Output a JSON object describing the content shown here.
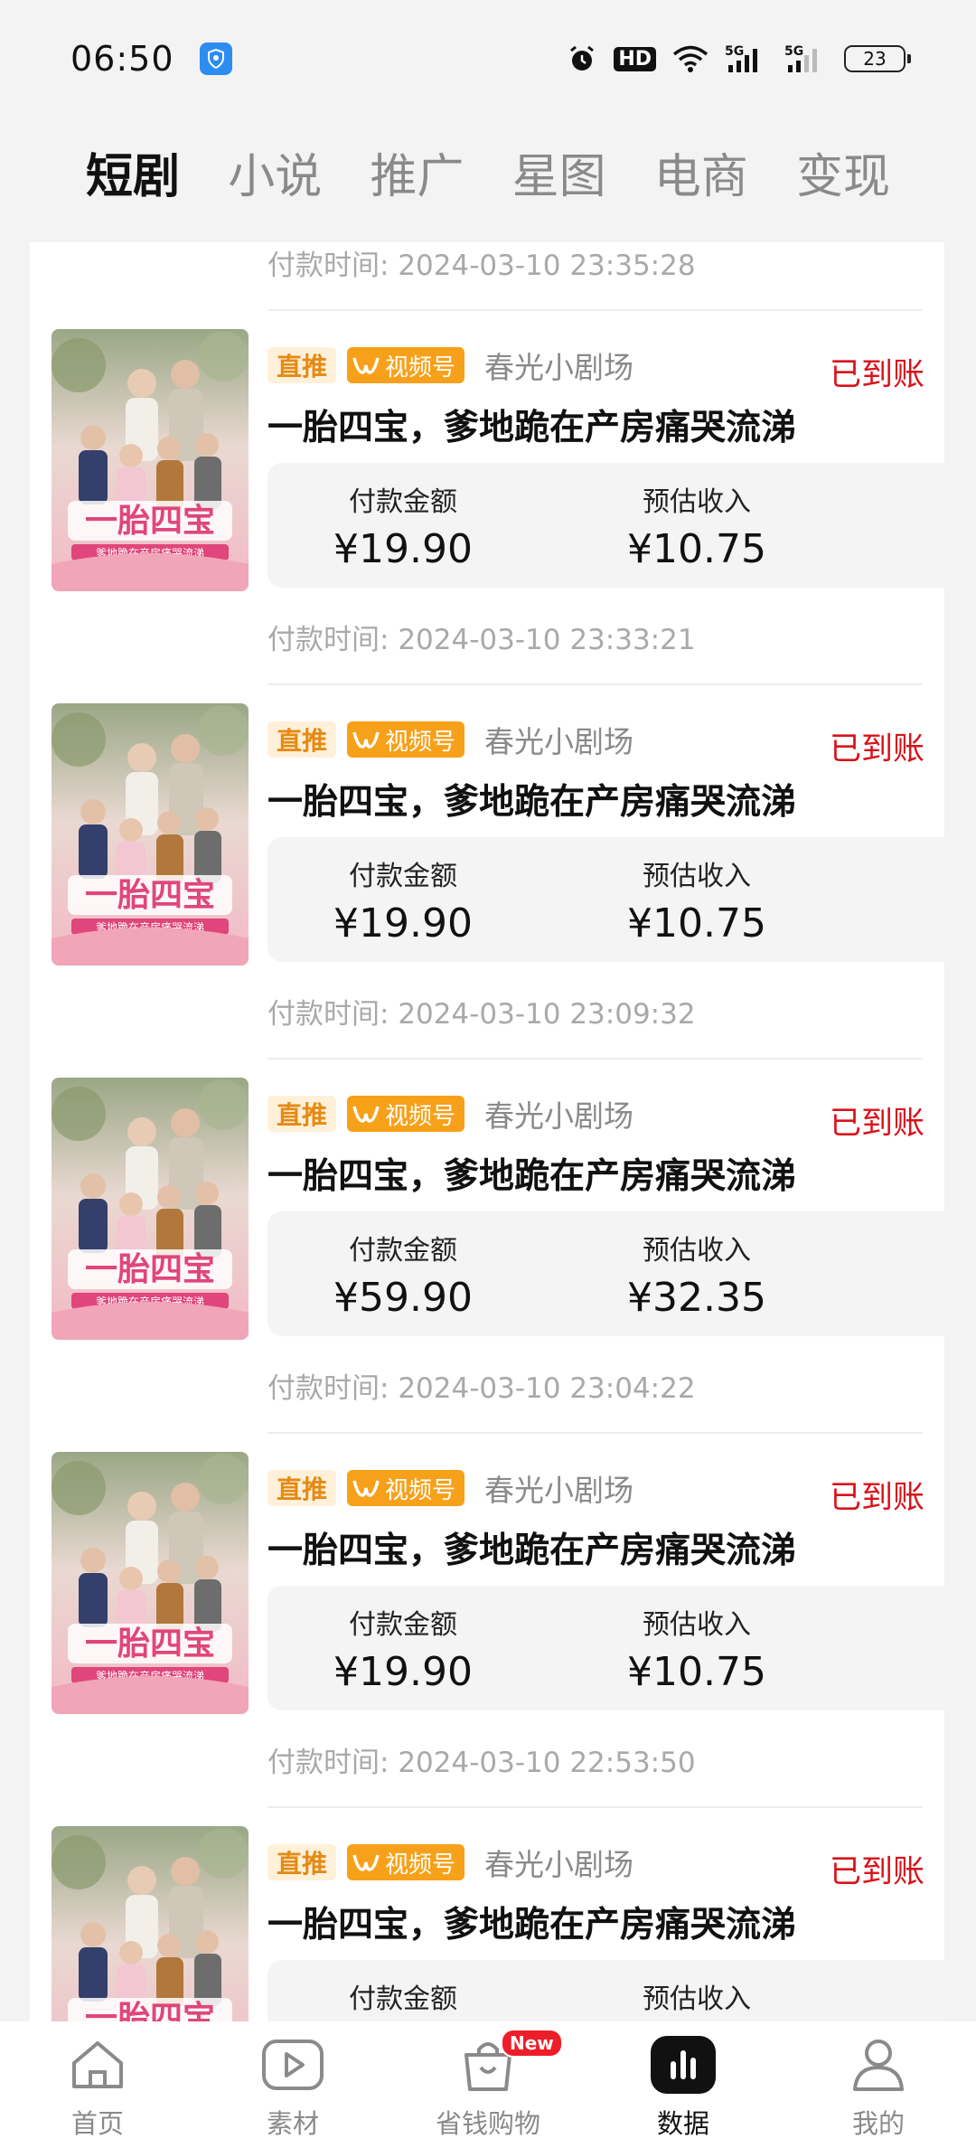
{
  "status_bar": {
    "time": "06:50",
    "hd_label": "HD",
    "signal1": "5G",
    "signal2": "5G",
    "battery": "23"
  },
  "tabs": [
    {
      "label": "短剧",
      "active": true
    },
    {
      "label": "小说",
      "active": false
    },
    {
      "label": "推广",
      "active": false
    },
    {
      "label": "星图",
      "active": false
    },
    {
      "label": "电商",
      "active": false
    },
    {
      "label": "变现",
      "active": false
    }
  ],
  "pay_time_label": "付款时间:",
  "orders_top_time": "2024-03-10 23:35:28",
  "orders": [
    {
      "tag_direct": "直推",
      "tag_channel": "视频号",
      "theater": "春光小剧场",
      "status": "已到账",
      "title": "一胎四宝，爹地跪在产房痛哭流涕",
      "pay_label": "付款金额",
      "pay_amount": "¥19.90",
      "income_label": "预估收入",
      "income_amount": "¥10.75",
      "pay_time": "2024-03-10 23:33:21"
    },
    {
      "tag_direct": "直推",
      "tag_channel": "视频号",
      "theater": "春光小剧场",
      "status": "已到账",
      "title": "一胎四宝，爹地跪在产房痛哭流涕",
      "pay_label": "付款金额",
      "pay_amount": "¥19.90",
      "income_label": "预估收入",
      "income_amount": "¥10.75",
      "pay_time": "2024-03-10 23:09:32"
    },
    {
      "tag_direct": "直推",
      "tag_channel": "视频号",
      "theater": "春光小剧场",
      "status": "已到账",
      "title": "一胎四宝，爹地跪在产房痛哭流涕",
      "pay_label": "付款金额",
      "pay_amount": "¥59.90",
      "income_label": "预估收入",
      "income_amount": "¥32.35",
      "pay_time": "2024-03-10 23:04:22"
    },
    {
      "tag_direct": "直推",
      "tag_channel": "视频号",
      "theater": "春光小剧场",
      "status": "已到账",
      "title": "一胎四宝，爹地跪在产房痛哭流涕",
      "pay_label": "付款金额",
      "pay_amount": "¥19.90",
      "income_label": "预估收入",
      "income_amount": "¥10.75",
      "pay_time": "2024-03-10 22:53:50"
    },
    {
      "tag_direct": "直推",
      "tag_channel": "视频号",
      "theater": "春光小剧场",
      "status": "已到账",
      "title": "一胎四宝，爹地跪在产房痛哭流涕",
      "pay_label": "付款金额",
      "pay_amount": "",
      "income_label": "预估收入",
      "income_amount": "",
      "pay_time": ""
    }
  ],
  "poster": {
    "title_art": "一胎四宝",
    "subtitle_art": "爹地跪在产房痛哭流涕"
  },
  "bottom_nav": [
    {
      "label": "首页",
      "icon": "home-icon",
      "active": false
    },
    {
      "label": "素材",
      "icon": "play-icon",
      "active": false
    },
    {
      "label": "省钱购物",
      "icon": "shopping-bag-icon",
      "active": false,
      "badge": "New"
    },
    {
      "label": "数据",
      "icon": "data-chart-icon",
      "active": true
    },
    {
      "label": "我的",
      "icon": "profile-icon",
      "active": false
    }
  ],
  "colors": {
    "status_red": "#d8131a",
    "tag_orange": "#f7a11a",
    "tag_direct_bg": "#fff0d9"
  }
}
